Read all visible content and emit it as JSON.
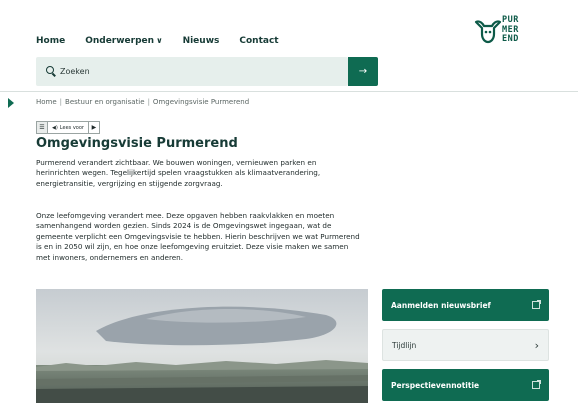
{
  "nav": {
    "items": [
      {
        "label": "Home",
        "has_dropdown": false
      },
      {
        "label": "Onderwerpen",
        "has_dropdown": true
      },
      {
        "label": "Nieuws",
        "has_dropdown": false
      },
      {
        "label": "Contact",
        "has_dropdown": false
      }
    ]
  },
  "logo": {
    "lines": [
      "PUR",
      "MER",
      "END"
    ]
  },
  "search": {
    "placeholder": "Zoeken",
    "button_icon": "→"
  },
  "breadcrumb": {
    "items": [
      "Home",
      "Bestuur en organisatie",
      "Omgevingsvisie Purmerend"
    ],
    "separator": "|"
  },
  "readspeaker": {
    "label": "Lees voor"
  },
  "page": {
    "title": "Omgevingsvisie Purmerend",
    "intro": "Purmerend verandert zichtbaar. We bouwen woningen, vernieuwen parken en herinrichten wegen. Tegelijkertijd spelen vraagstukken als klimaatverandering, energietransitie, vergrijzing en stijgende zorgvraag.",
    "body": "Onze leefomgeving verandert mee. Deze opgaven hebben raakvlakken en moeten samenhangend worden gezien. Sinds 2024 is de Omgevingswet ingegaan, wat de gemeente verplicht een Omgevingsvisie te hebben. Hierin beschrijven we wat Purmerend is en in 2050 wil zijn, en hoe onze leefomgeving eruitziet. Deze visie maken we samen met inwoners, ondernemers en anderen."
  },
  "sidebar": {
    "links": [
      {
        "label": "Aanmelden nieuwsbrief",
        "style": "primary",
        "icon": "external-link-icon"
      },
      {
        "label": "Tijdlijn",
        "style": "secondary",
        "icon": "chevron-right-icon"
      },
      {
        "label": "Perspectievennotitie",
        "style": "primary",
        "icon": "external-link-icon"
      }
    ]
  },
  "colors": {
    "brand": "#0f6b52",
    "text_dark": "#173b36",
    "search_bg": "#e6efec"
  }
}
